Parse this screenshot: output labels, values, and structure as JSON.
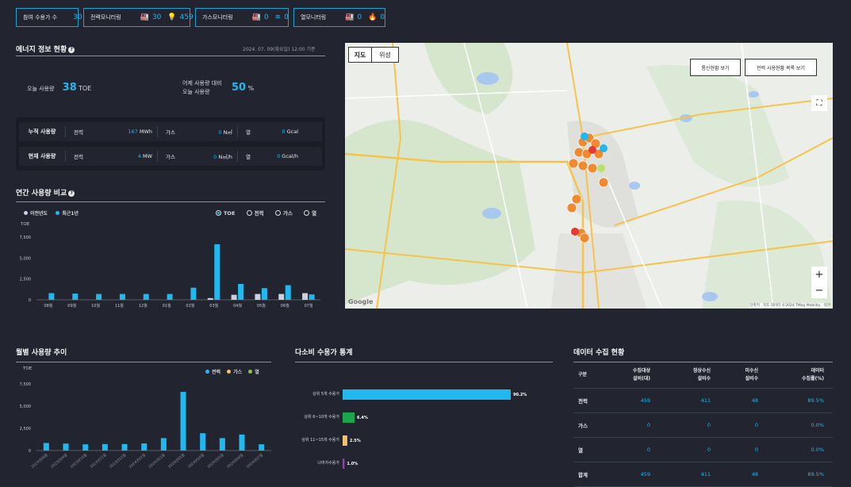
{
  "top_bar": [
    {
      "label": "참여 수용가 수",
      "items": [
        {
          "icon": "",
          "value": "30"
        }
      ]
    },
    {
      "label": "전력모니터링",
      "items": [
        {
          "icon": "factory-icon",
          "value": "30"
        },
        {
          "icon": "bulb-icon",
          "value": "459"
        }
      ]
    },
    {
      "label": "가스모니터링",
      "items": [
        {
          "icon": "factory-icon",
          "value": "0"
        },
        {
          "icon": "wave-icon",
          "value": "0"
        }
      ]
    },
    {
      "label": "열모니터링",
      "items": [
        {
          "icon": "factory-icon",
          "value": "0"
        },
        {
          "icon": "flame-icon",
          "value": "0"
        }
      ]
    }
  ],
  "energy": {
    "title": "에너지 정보 현황",
    "timestamp": "2024. 07. 09(화요일) 12:00 기준",
    "today_label": "오늘 사용량",
    "today_value": "38",
    "today_unit": "TOE",
    "compare_label_1": "어제 사용량 대비",
    "compare_label_2": "오늘 사용량",
    "compare_value": "50",
    "compare_unit": "%",
    "rows": [
      {
        "label": "누적 사용량",
        "power_k": "전력",
        "power_v": "167",
        "power_u": "MWh",
        "gas_k": "가스",
        "gas_v": "0",
        "gas_u": "N㎥",
        "heat_k": "열",
        "heat_v": "0",
        "heat_u": "Gcal"
      },
      {
        "label": "현재 사용량",
        "power_k": "전력",
        "power_v": "4",
        "power_u": "MW",
        "gas_k": "가스",
        "gas_v": "0",
        "gas_u": "N㎥/h",
        "heat_k": "열",
        "heat_v": "0",
        "heat_u": "Gcal/h"
      }
    ]
  },
  "annual": {
    "title": "연간 사용량 비교",
    "legend_prev": "이전년도",
    "legend_recent": "최근1년",
    "radios": [
      "TOE",
      "전력",
      "가스",
      "열"
    ],
    "selected": "TOE"
  },
  "map": {
    "tab_map": "지도",
    "tab_sat": "위성",
    "btn_comm": "통신현황 보기",
    "btn_list": "전력 사용현황 목록 보기",
    "zoom_in": "+",
    "zoom_out": "−",
    "logo": "Google",
    "attribution": "단축키   지도 데이터 ©2024 TMap Mobility   약관"
  },
  "monthly": {
    "title": "월별 사용량 추이",
    "legend": [
      "전력",
      "가스",
      "열"
    ]
  },
  "major": {
    "title": "다소비 수용가 통계"
  },
  "collect": {
    "title": "데이터 수집 현황",
    "headers": [
      "구분",
      "수집대상\n설비(대)",
      "정상수신\n설비수",
      "미수신\n설비수",
      "데이터\n수집률(%)"
    ],
    "rows": [
      [
        "전력",
        "459",
        "411",
        "48",
        "89.5%"
      ],
      [
        "가스",
        "0",
        "0",
        "0",
        "0.0%"
      ],
      [
        "열",
        "0",
        "0",
        "0",
        "0.0%"
      ],
      [
        "합계",
        "459",
        "411",
        "48",
        "89.5%"
      ]
    ]
  },
  "colors": {
    "accent": "#21b7ef",
    "prev": "#c9d0e0",
    "gas": "#f5c26b",
    "heat": "#8bc34a",
    "green": "#1aa64a",
    "purple": "#8e44ad"
  },
  "chart_data": [
    {
      "type": "bar",
      "title": "연간 사용량 비교",
      "ylabel": "TOE",
      "ylim": [
        0,
        7500
      ],
      "yticks": [
        "0",
        "2,500",
        "5,000",
        "7,500"
      ],
      "categories": [
        "08월",
        "09월",
        "10월",
        "11월",
        "12월",
        "01월",
        "02월",
        "03월",
        "04월",
        "05월",
        "06월",
        "07월"
      ],
      "series": [
        {
          "name": "이전년도",
          "values": [
            0,
            0,
            0,
            0,
            0,
            0,
            0,
            200,
            600,
            700,
            700,
            800
          ]
        },
        {
          "name": "최근1년",
          "values": [
            800,
            750,
            700,
            700,
            700,
            700,
            1450,
            6650,
            1900,
            1400,
            1750,
            650
          ]
        }
      ]
    },
    {
      "type": "bar",
      "title": "월별 사용량 추이",
      "ylabel": "TOE",
      "ylim": [
        0,
        7500
      ],
      "yticks": [
        "0",
        "2,500",
        "5,000",
        "7,500"
      ],
      "categories": [
        "2023년08월",
        "2023년09월",
        "2023년10월",
        "2023년11월",
        "2023년12월",
        "2024년01월",
        "2024년02월",
        "2024년03월",
        "2024년04월",
        "2024년05월",
        "2024년06월",
        "2024년07월"
      ],
      "series": [
        {
          "name": "전력",
          "values": [
            850,
            780,
            700,
            720,
            730,
            800,
            1400,
            6600,
            1950,
            1400,
            1800,
            700
          ]
        }
      ]
    },
    {
      "type": "bar",
      "title": "다소비 수용가 통계",
      "orientation": "horizontal",
      "categories": [
        "상위 5개 수용가",
        "상위 6~10개 수용가",
        "상위 11~15개 수용가",
        "나머지수용가"
      ],
      "values": [
        90.2,
        6.4,
        2.5,
        1.0
      ],
      "value_labels": [
        "90.2%",
        "6.4%",
        "2.5%",
        "1.0%"
      ]
    }
  ]
}
